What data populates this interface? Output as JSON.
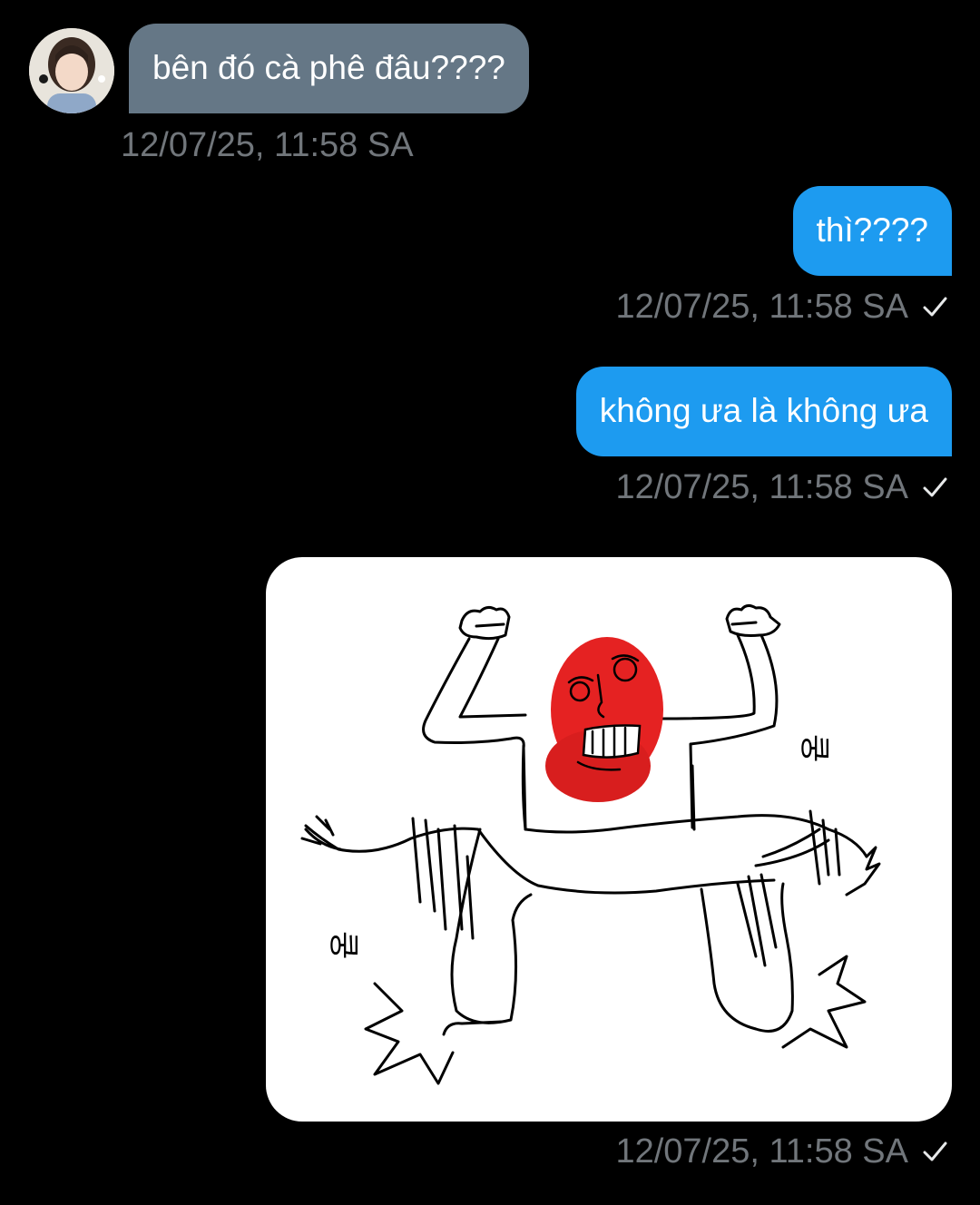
{
  "conversation": {
    "messages": [
      {
        "direction": "incoming",
        "text": "bên đó cà phê đâu????",
        "time": "12/07/25, 11:58 SA"
      },
      {
        "direction": "outgoing",
        "text": "thì????",
        "time": "12/07/25, 11:58 SA"
      },
      {
        "direction": "outgoing",
        "text": "không ưa là không ưa",
        "time": "12/07/25, 11:58 SA"
      },
      {
        "direction": "outgoing",
        "type": "image",
        "image_text_top": "쿵",
        "image_text_bottom": "쿵",
        "time": "12/07/25, 11:58 SA"
      }
    ]
  },
  "colors": {
    "background": "#000000",
    "incoming_bubble": "#657786",
    "outgoing_bubble": "#1d9bf0",
    "timestamp": "#71767b"
  },
  "icons": {
    "sent_status": "check-icon",
    "avatar": "user-avatar"
  }
}
